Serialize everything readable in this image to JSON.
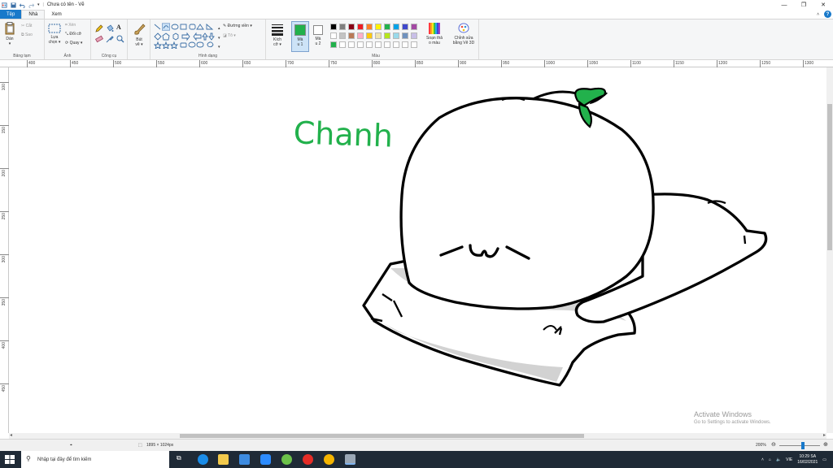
{
  "titlebar": {
    "title": "Chưa có tên - Vẽ",
    "min_icon": "minimize-icon",
    "max_icon": "maximize-icon",
    "close_icon": "close-icon"
  },
  "tabs": [
    {
      "label": "Tệp"
    },
    {
      "label": "Nhà"
    },
    {
      "label": "Xem"
    }
  ],
  "ribbon": {
    "clipboard": {
      "paste": "Dán",
      "paste_sub": "▾",
      "cut": "Cắt",
      "copy": "Sao",
      "label": "Bảng tạm"
    },
    "image": {
      "select": "Lựa",
      "select_sub": "chọn ▾",
      "crop": "Xén",
      "resize": "Đổi cỡ",
      "rotate": "Quay ▾",
      "label": "Ảnh"
    },
    "tools": {
      "label": "Công cụ"
    },
    "brushes": {
      "label": "Bút",
      "sub": "vẽ ▾"
    },
    "shapes": {
      "outline": "Đường viền ▾",
      "fill": "Tô ▾",
      "label": "Hình dạng"
    },
    "size": {
      "label": "Kích",
      "sub": "cỡ ▾"
    },
    "color1": {
      "label": "Mà",
      "sub": "u 1",
      "value": "#22b14c"
    },
    "color2": {
      "label": "Mà",
      "sub": "u 2",
      "value": "#ffffff"
    },
    "colors": {
      "label": "Màu",
      "row1": [
        "#000000",
        "#7f7f7f",
        "#880015",
        "#ed1c24",
        "#ff7f27",
        "#fff200",
        "#22b14c",
        "#00a2e8",
        "#3f48cc",
        "#a349a4"
      ],
      "row2": [
        "#ffffff",
        "#c3c3c3",
        "#b97a57",
        "#ffaec9",
        "#ffc90e",
        "#efe4b0",
        "#b5e61d",
        "#99d9ea",
        "#7092be",
        "#c8bfe7"
      ],
      "row3": [
        "#22b14c",
        "#ffffff",
        "#ffffff",
        "#ffffff",
        "#ffffff",
        "#ffffff",
        "#ffffff",
        "#ffffff",
        "#ffffff",
        "#ffffff"
      ]
    },
    "edit_colors": {
      "label": "Soạn thả",
      "sub": "o màu"
    },
    "paint3d": {
      "label": "Chỉnh sửa",
      "sub": "bằng Vẽ 3D"
    }
  },
  "ruler": {
    "h_ticks": [
      "400",
      "450",
      "500",
      "550",
      "600",
      "650",
      "700",
      "750",
      "800",
      "850",
      "900",
      "950",
      "1000",
      "1050",
      "1100",
      "1150",
      "1200",
      "1250",
      "1300"
    ],
    "v_ticks": [
      "100",
      "150",
      "200",
      "250",
      "300",
      "350",
      "400",
      "450"
    ]
  },
  "canvas": {
    "handwriting": "Chanh",
    "handwriting_color": "#22b14c"
  },
  "status": {
    "size": "1895 × 1024px",
    "zoom": "200%"
  },
  "watermark": {
    "line1": "Activate Windows",
    "line2": "Go to Settings to activate Windows."
  },
  "taskbar": {
    "search_placeholder": "Nhập tại đây để tìm kiếm",
    "lang": "VIE",
    "time": "10:29 SA",
    "date": "16/02/2021"
  }
}
